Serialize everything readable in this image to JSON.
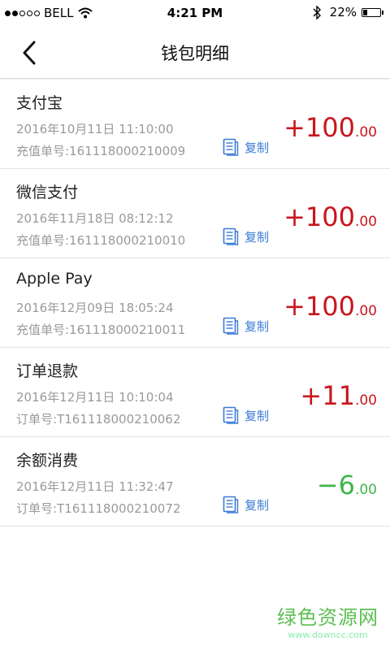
{
  "status_bar": {
    "carrier": "BELL",
    "time": "4:21 PM",
    "battery": "22%",
    "battery_level": 0.22
  },
  "header": {
    "title": "钱包明细"
  },
  "transactions": [
    {
      "name": "支付宝",
      "datetime": "2016年10月11日 11:10:00",
      "order": "充值单号:161118000210009",
      "copy_label": "复制",
      "amount_int": "+100",
      "amount_dec": ".00",
      "type": "credit"
    },
    {
      "name": "微信支付",
      "datetime": "2016年11月18日 08:12:12",
      "order": "充值单号:161118000210010",
      "copy_label": "复制",
      "amount_int": "+100",
      "amount_dec": ".00",
      "type": "credit"
    },
    {
      "name": "Apple Pay",
      "datetime": "2016年12月09日 18:05:24",
      "order": "充值单号:161118000210011",
      "copy_label": "复制",
      "amount_int": "+100",
      "amount_dec": ".00",
      "type": "credit"
    },
    {
      "name": "订单退款",
      "datetime": "2016年12月11日 10:10:04",
      "order": "订单号:T161118000210062",
      "copy_label": "复制",
      "amount_int": "+11",
      "amount_dec": ".00",
      "type": "credit"
    },
    {
      "name": "余额消费",
      "datetime": "2016年12月11日 11:32:47",
      "order": "订单号:T161118000210072",
      "copy_label": "复制",
      "amount_int": "−6",
      "amount_dec": ".00",
      "type": "debit"
    }
  ],
  "colors": {
    "credit": "#c8161d",
    "debit": "#3cb64a",
    "link": "#3a7bd5"
  },
  "watermark": {
    "main": "绿色资源网",
    "sub": "www.downcc.com"
  }
}
